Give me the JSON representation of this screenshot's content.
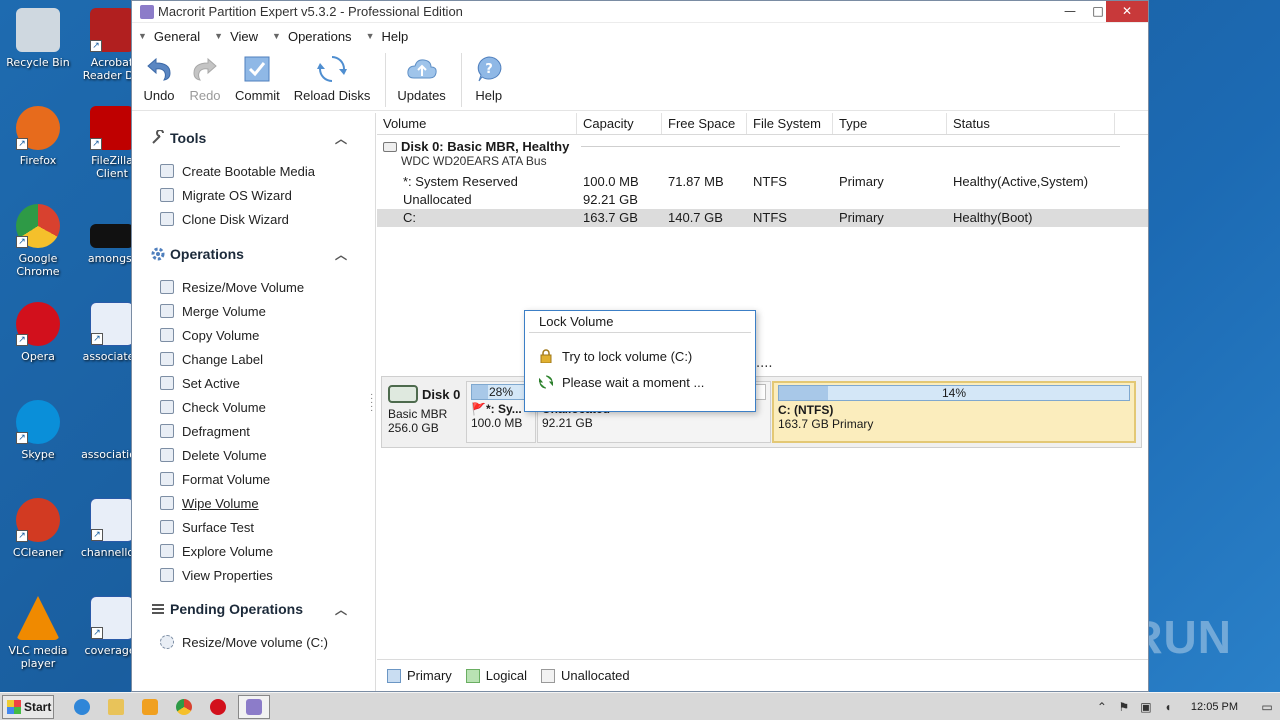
{
  "desktop": {
    "icons": [
      {
        "label": "Recycle Bin",
        "color": "#cfd8e0"
      },
      {
        "label": "Acrobat Reader DC",
        "color": "#b11f1f"
      },
      {
        "label": "Firefox",
        "color": "#e76b1c"
      },
      {
        "label": "FileZilla Client",
        "color": "#bf0000"
      },
      {
        "label": "Google Chrome",
        "color": "#2e9a46"
      },
      {
        "label": "amongst",
        "color": "#111111"
      },
      {
        "label": "Opera",
        "color": "#d2101c"
      },
      {
        "label": "associated",
        "color": "#2a5aa8"
      },
      {
        "label": "Skype",
        "color": "#0a8fd9"
      },
      {
        "label": "association",
        "color": "#2a5aa8"
      },
      {
        "label": "CCleaner",
        "color": "#d23a22"
      },
      {
        "label": "channellow",
        "color": "#2a5aa8"
      },
      {
        "label": "VLC media player",
        "color": "#f08a00"
      },
      {
        "label": "coveragef",
        "color": "#2a5aa8"
      }
    ],
    "watermark": "ANY RUN"
  },
  "window": {
    "title": "Macrorit Partition Expert v5.3.2 - Professional Edition",
    "controls": {
      "minimize": "—",
      "maximize": "□",
      "close": "✕"
    }
  },
  "menu": [
    {
      "label": "General"
    },
    {
      "label": "View"
    },
    {
      "label": "Operations"
    },
    {
      "label": "Help"
    }
  ],
  "toolbar": {
    "undo": "Undo",
    "redo": "Redo",
    "commit": "Commit",
    "reload": "Reload Disks",
    "updates": "Updates",
    "help": "Help"
  },
  "sidebar": {
    "tools": {
      "title": "Tools",
      "items": [
        "Create Bootable Media",
        "Migrate OS Wizard",
        "Clone Disk Wizard"
      ]
    },
    "operations": {
      "title": "Operations",
      "items": [
        "Resize/Move Volume",
        "Merge Volume",
        "Copy Volume",
        "Change Label",
        "Set Active",
        "Check Volume",
        "Defragment",
        "Delete Volume",
        "Format Volume",
        "Wipe Volume",
        "Surface Test",
        "Explore Volume",
        "View Properties"
      ]
    },
    "pending": {
      "title": "Pending Operations",
      "items": [
        "Resize/Move volume (C:)"
      ]
    }
  },
  "table": {
    "columns": [
      "Volume",
      "Capacity",
      "Free Space",
      "File System",
      "Type",
      "Status"
    ],
    "disk": {
      "name": "Disk 0: Basic MBR, Healthy",
      "sub": "WDC WD20EARS ATA Bus"
    },
    "rows": [
      {
        "volume": "*: System Reserved",
        "capacity": "100.0 MB",
        "free": "71.87 MB",
        "fs": "NTFS",
        "type": "Primary",
        "status": "Healthy(Active,System)"
      },
      {
        "volume": "Unallocated",
        "capacity": "92.21 GB",
        "free": "",
        "fs": "",
        "type": "",
        "status": ""
      },
      {
        "volume": "C:",
        "capacity": "163.7 GB",
        "free": "140.7 GB",
        "fs": "NTFS",
        "type": "Primary",
        "status": "Healthy(Boot)"
      }
    ]
  },
  "diskmap": {
    "disk": {
      "name": "Disk 0",
      "type": "Basic MBR",
      "size": "256.0 GB"
    },
    "parts": [
      {
        "pct_label": "28%",
        "used_fraction": 0.28,
        "label": "*: Sy...",
        "size": "100.0 MB"
      },
      {
        "pct_label": "",
        "label": "Unallocated",
        "size": "92.21 GB"
      },
      {
        "pct_label": "14%",
        "used_fraction": 0.14,
        "label": "C: (NTFS)",
        "size": "163.7 GB Primary"
      }
    ]
  },
  "legend": [
    {
      "label": "Primary",
      "color": "#c9ddf2"
    },
    {
      "label": "Logical",
      "color": "#b9e2b3"
    },
    {
      "label": "Unallocated",
      "color": "#f2f2f2"
    }
  ],
  "dialog": {
    "title": "Lock Volume",
    "line1": "Try to lock volume (C:)",
    "line2": "Please wait a moment ..."
  },
  "dots": "....",
  "taskbar": {
    "start": "Start",
    "clock": "12:05 PM"
  }
}
